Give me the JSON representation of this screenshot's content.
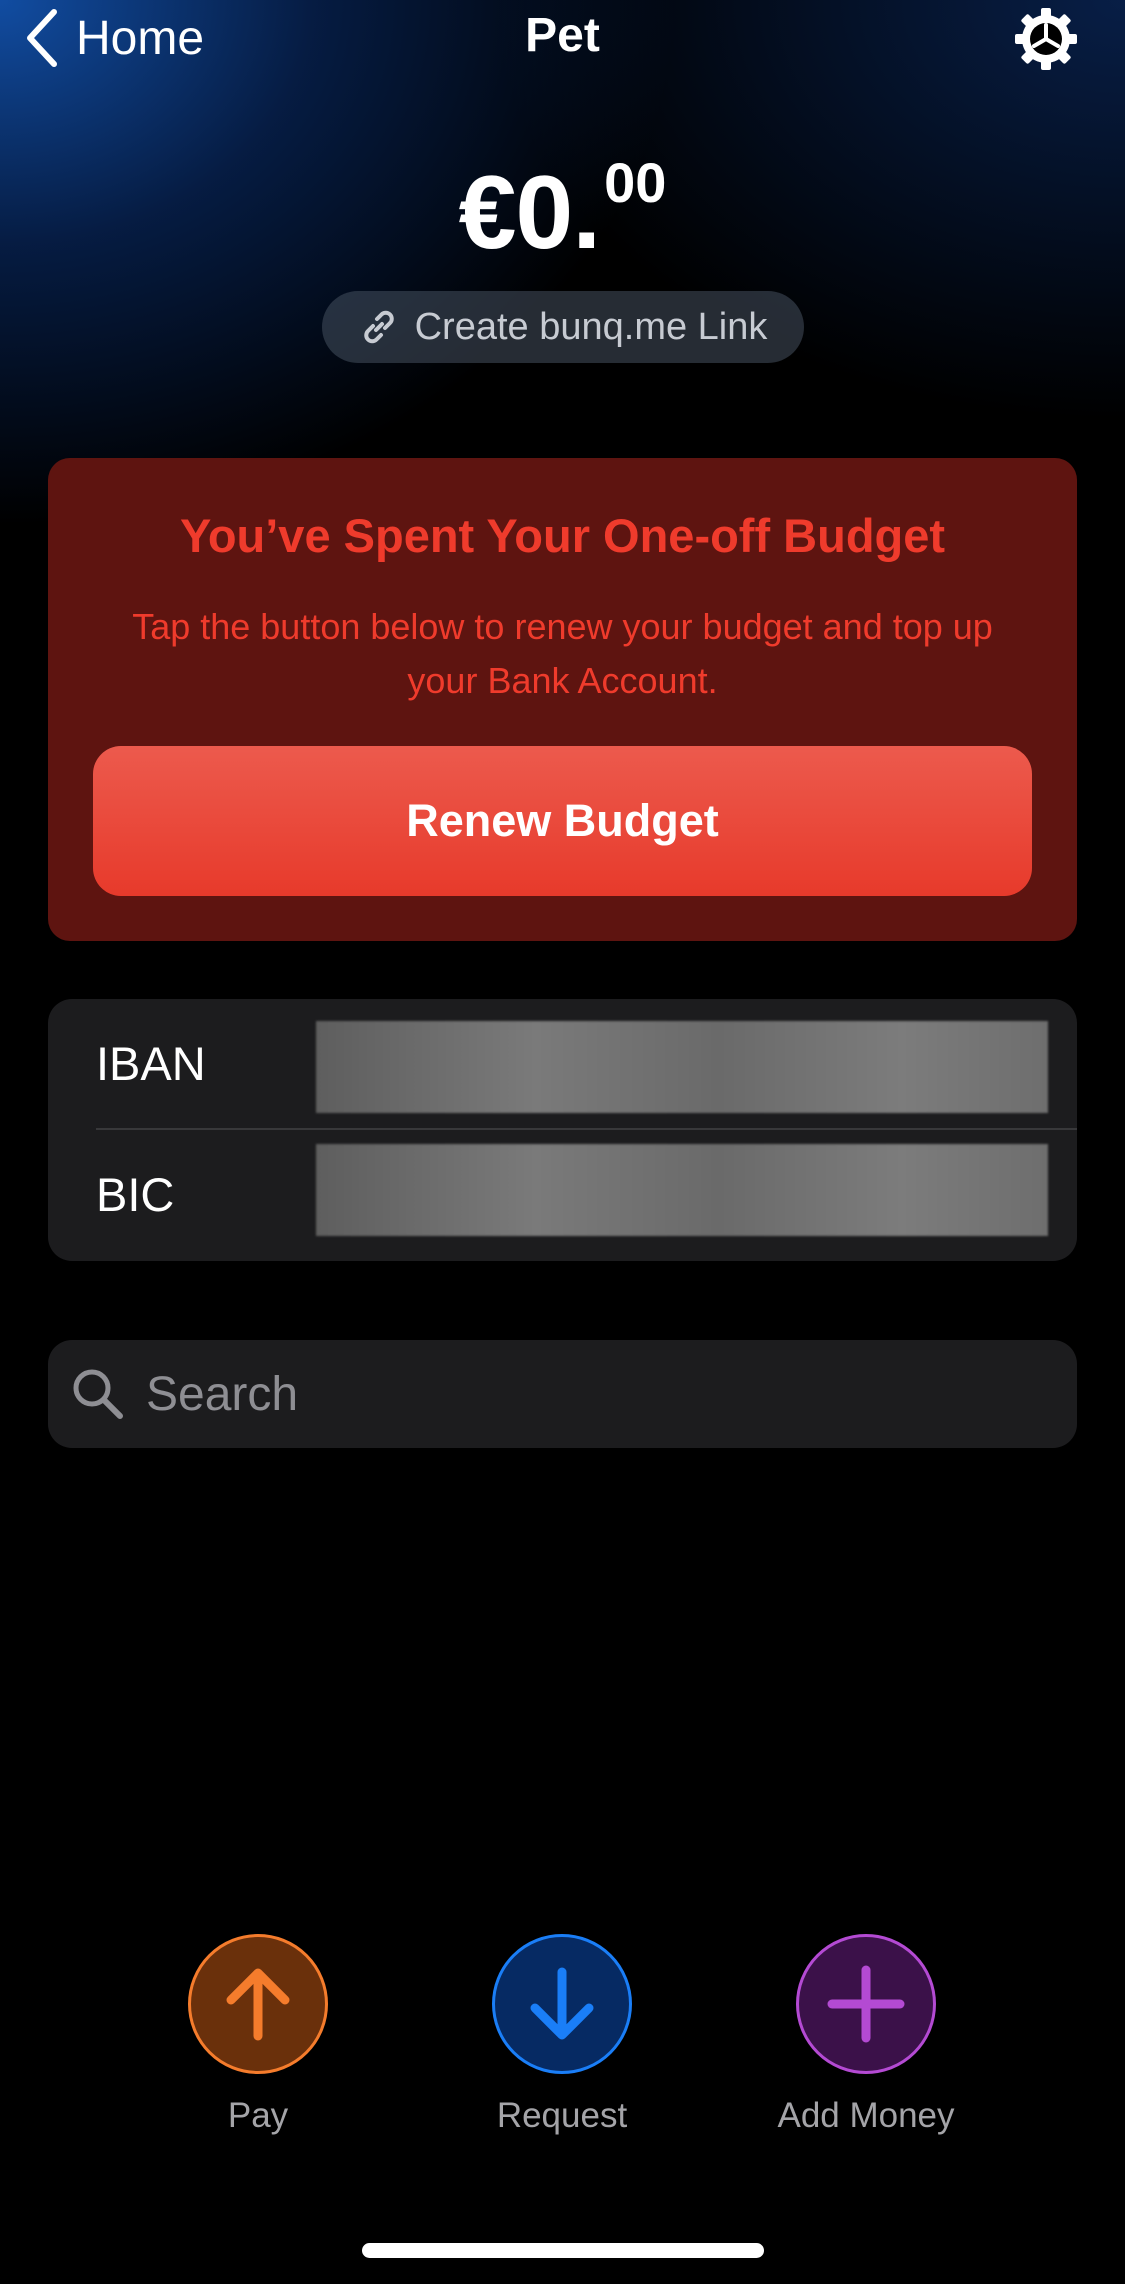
{
  "navbar": {
    "back_label": "Home",
    "title": "Pet",
    "back_icon": "chevron-left-icon",
    "settings_icon": "gear-icon"
  },
  "balance": {
    "main": "€0.",
    "cents": "00"
  },
  "bunq_link": {
    "label": "Create bunq.me Link",
    "icon": "link-icon"
  },
  "budget_alert": {
    "title": "You’ve Spent Your One-off Budget",
    "description": "Tap the button below to renew your budget and top up your Bank Account.",
    "button_label": "Renew Budget",
    "colors": {
      "card": "#5e1410",
      "text": "#ef3b2c",
      "button": "#e73a2b"
    }
  },
  "bank_details": {
    "iban_label": "IBAN",
    "bic_label": "BIC"
  },
  "search": {
    "placeholder": "Search",
    "icon": "search-icon"
  },
  "actions": {
    "pay_label": "Pay",
    "request_label": "Request",
    "add_money_label": "Add Money",
    "colors": {
      "pay": "#f57c2c",
      "request": "#1a7ef7",
      "add_money": "#b44ad3"
    }
  }
}
